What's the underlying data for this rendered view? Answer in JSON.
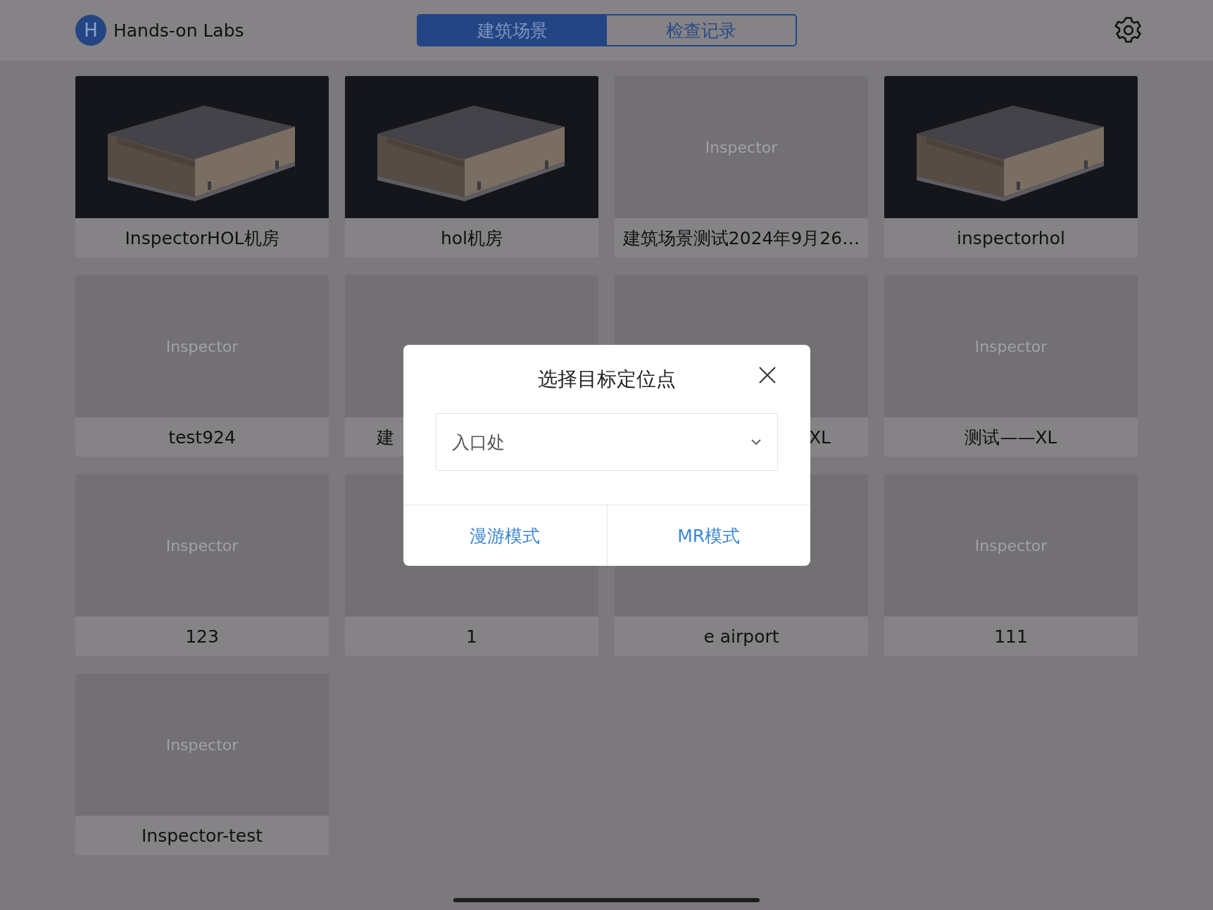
{
  "header": {
    "avatar_letter": "H",
    "title": "Hands-on Labs",
    "tabs": [
      {
        "label": "建筑场景",
        "selected": true
      },
      {
        "label": "检查记录",
        "selected": false
      }
    ]
  },
  "cards": [
    {
      "kind": "model",
      "label": "InspectorHOL机房"
    },
    {
      "kind": "model",
      "label": "hol机房"
    },
    {
      "kind": "placeholder",
      "placeholder_text": "Inspector",
      "label": "建筑场景测试2024年9月26…"
    },
    {
      "kind": "model",
      "label": "inspectorhol"
    },
    {
      "kind": "placeholder",
      "placeholder_text": "Inspector",
      "label": "test924"
    },
    {
      "kind": "placeholder",
      "label": "建",
      "covered_right": true
    },
    {
      "kind": "placeholder",
      "label": "XL",
      "covered_left": true
    },
    {
      "kind": "placeholder",
      "placeholder_text": "Inspector",
      "label": "测试——XL"
    },
    {
      "kind": "placeholder",
      "placeholder_text": "Inspector",
      "label": "123"
    },
    {
      "kind": "placeholder",
      "label": "1"
    },
    {
      "kind": "placeholder",
      "label": "e airport"
    },
    {
      "kind": "placeholder",
      "placeholder_text": "Inspector",
      "label": "111"
    },
    {
      "kind": "placeholder",
      "placeholder_text": "Inspector",
      "label": "Inspector-test"
    }
  ],
  "dialog": {
    "title": "选择目标定位点",
    "select": {
      "value": "入口处"
    },
    "buttons": [
      "漫游模式",
      "MR模式"
    ]
  }
}
